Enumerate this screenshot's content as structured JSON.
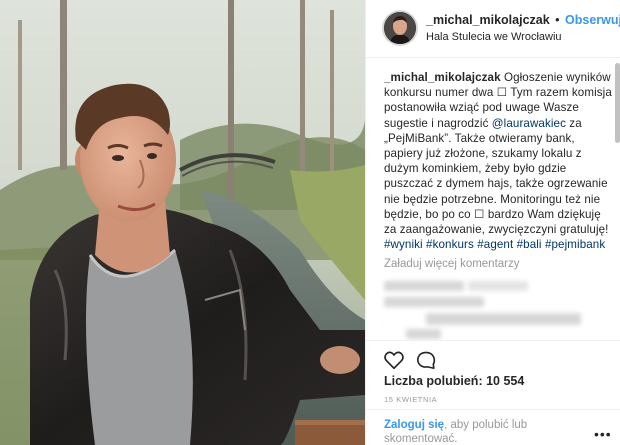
{
  "header": {
    "username": "_michal_mikolajczak",
    "separator": "•",
    "follow_label": "Obserwuj",
    "location": "Hala Stulecia we Wrocławiu"
  },
  "caption": {
    "username": "_michal_mikolajczak",
    "text_1": " Ogłoszenie wyników konkursu numer dwa",
    "box_1": " ☐",
    "text_2": " Tym razem komisja postanowiła wziąć pod uwage Wasze sugestie i nagrodzić ",
    "mention": "@laurawakiec",
    "text_3": " za „PejMiBank”. Także otwieramy bank, papiery już złożone, szukamy lokalu z dużym kominkiem, żeby było gdzie puszczać z dymem hajs, także ogrzewanie nie będzie potrzebne. Monitoringu też nie będzie, bo po co",
    "box_2": " ☐",
    "text_4": " bardzo Wam dziękuję za zaangażowanie, zwycięzczyni gratuluję! ",
    "hashtags": [
      "#wyniki",
      "#konkurs",
      "#agent",
      "#bali",
      "#pejmibank"
    ]
  },
  "comments": {
    "load_more_label": "Załaduj więcej komentarzy"
  },
  "actions": {
    "like_icon": "heart-icon",
    "comment_icon": "comment-bubble-icon",
    "likes_label": "Liczba polubień: 10 554",
    "date": "15 kwietnia"
  },
  "login": {
    "link_label": "Zaloguj się",
    "rest": ", aby polubić lub skomentować.",
    "more_icon": "more-options-icon",
    "more_glyph": "•••"
  },
  "colors": {
    "link_blue": "#3897f0",
    "hashtag_blue": "#003569",
    "muted_gray": "#999999",
    "text": "#262626",
    "border": "#efefef"
  }
}
